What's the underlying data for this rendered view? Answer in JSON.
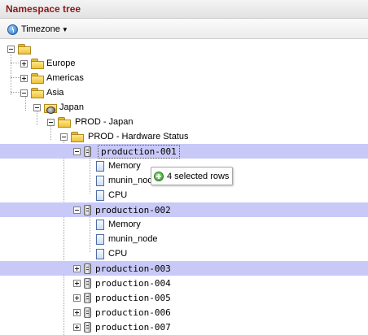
{
  "header": {
    "title": "Namespace tree"
  },
  "toolbar": {
    "timezone_label": "Timezone"
  },
  "tree": {
    "root": "",
    "europe": "Europe",
    "americas": "Americas",
    "asia": "Asia",
    "japan": "Japan",
    "prod_japan": "PROD - Japan",
    "prod_hw": "PROD - Hardware Status",
    "p001": "production-001",
    "p001_memory": "Memory",
    "p001_munin": "munin_node",
    "p001_cpu": "CPU",
    "p002": "production-002",
    "p002_memory": "Memory",
    "p002_munin": "munin_node",
    "p002_cpu": "CPU",
    "p003": "production-003",
    "p004": "production-004",
    "p005": "production-005",
    "p006": "production-006",
    "p007": "production-007"
  },
  "tooltip": {
    "text": "4 selected rows"
  },
  "colors": {
    "header_title": "#8b1a1a",
    "selection": "#c9c9f8"
  }
}
